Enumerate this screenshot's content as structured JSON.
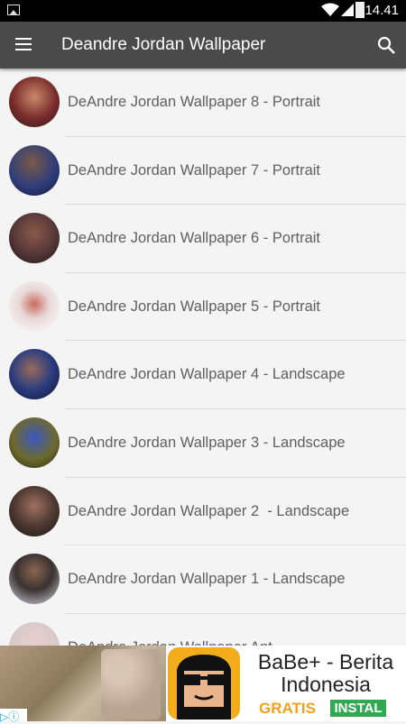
{
  "status_bar": {
    "time": "14.41",
    "icons": [
      "image-notification-icon",
      "wifi-icon",
      "signal-icon",
      "battery-icon"
    ]
  },
  "toolbar": {
    "title": "Deandre Jordan Wallpaper",
    "menu_icon": "hamburger-menu-icon",
    "search_icon": "search-icon",
    "background": "#4a4a4a"
  },
  "list": {
    "items": [
      {
        "label": "DeAndre Jordan Wallpaper 8 - Portrait",
        "thumb": "#7a2b2b"
      },
      {
        "label": "DeAndre Jordan Wallpaper 7 - Portrait",
        "thumb": "#2f3d7a"
      },
      {
        "label": "DeAndre Jordan Wallpaper 6 - Portrait",
        "thumb": "#5a3a3a"
      },
      {
        "label": "DeAndre Jordan Wallpaper 5 - Portrait",
        "thumb": "#f2e9e9"
      },
      {
        "label": "DeAndre Jordan Wallpaper 4 - Landscape",
        "thumb": "#2b3d80"
      },
      {
        "label": "DeAndre Jordan Wallpaper 3 - Landscape",
        "thumb": "#6e6a2e"
      },
      {
        "label": "DeAndre Jordan Wallpaper 2  - Landscape",
        "thumb": "#4f3a32"
      },
      {
        "label": "DeAndre Jordan Wallpaper 1 - Landscape",
        "thumb": "#3a3230"
      },
      {
        "label": "DeAndre Jordan Wallpaper Ant...",
        "thumb": "#d8c8c8"
      }
    ]
  },
  "ad_banner": {
    "headline": "BaBe+ - Berita Indonesia",
    "price": "GRATIS",
    "cta": "INSTAL",
    "brand_color": "#f3ad1c",
    "cta_color": "#32a852"
  }
}
